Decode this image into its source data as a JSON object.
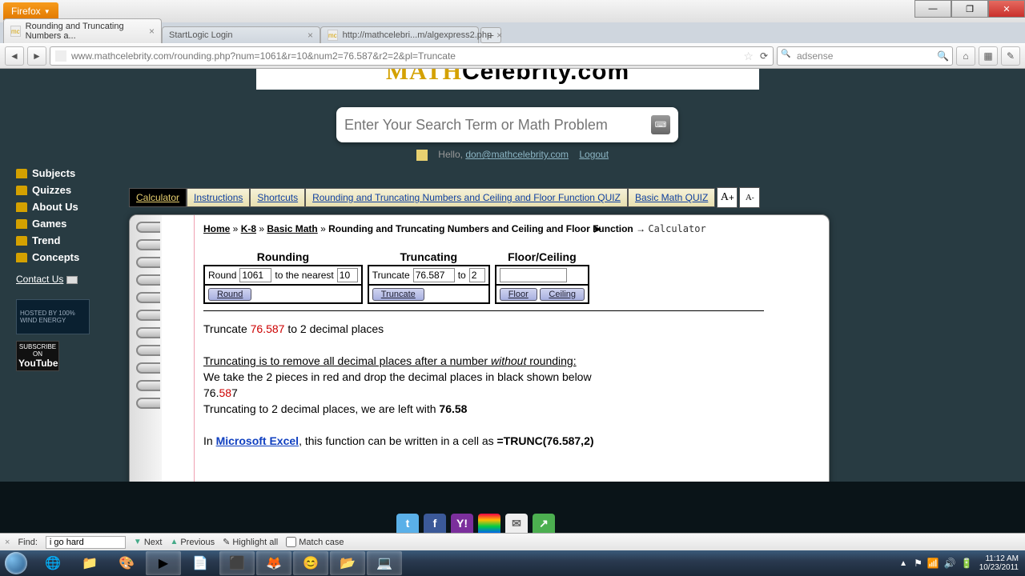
{
  "browser": {
    "menu_label": "Firefox",
    "tabs": [
      {
        "title": "Rounding and Truncating Numbers a...",
        "active": true
      },
      {
        "title": "StartLogic Login",
        "active": false
      },
      {
        "title": "http://mathcelebri...m/algexpress2.php",
        "active": false
      }
    ],
    "url": "www.mathcelebrity.com/rounding.php?num=1061&r=10&num2=76.587&r2=2&pl=Truncate",
    "search_placeholder": "adsense"
  },
  "page": {
    "logo_math": "MATH",
    "logo_rest": "Celebrity.com",
    "search_placeholder": "Enter Your Search Term or Math Problem",
    "hello": "Hello,",
    "email": "don@mathcelebrity.com",
    "logout": "Logout",
    "sidebar": [
      "Subjects",
      "Quizzes",
      "About Us",
      "Games",
      "Trend",
      "Concepts"
    ],
    "contact": "Contact Us",
    "wind_badge": "HOSTED BY 100% WIND ENERGY",
    "yt_sub": "SUBSCRIBE ON",
    "yt": "YouTube",
    "qtabs": [
      "Calculator",
      "Instructions",
      "Shortcuts",
      "Rounding and Truncating Numbers and Ceiling and Floor Function QUIZ",
      "Basic Math QUIZ"
    ],
    "font_big": "A ̂",
    "font_small": "A ˇ",
    "crumb": {
      "home": "Home",
      "k8": "K-8",
      "basic": "Basic Math",
      "topic": "Rounding and Truncating Numbers and Ceiling and Floor Function",
      "arrow": "→",
      "cur": "Calculator"
    },
    "headers": {
      "round": "Rounding",
      "trunc": "Truncating",
      "fc": "Floor/Ceiling"
    },
    "round": {
      "lbl": "Round",
      "val": "1061",
      "mid": "to the nearest",
      "to": "10",
      "btn": "Round"
    },
    "trunc": {
      "lbl": "Truncate",
      "val": "76.587",
      "mid": "to",
      "to": "2",
      "btn": "Truncate"
    },
    "fc": {
      "val": "",
      "floor": "Floor",
      "ceil": "Ceiling"
    },
    "explain": {
      "l1a": "Truncate ",
      "l1b": "76.587",
      "l1c": " to 2 decimal places",
      "l2a": "Truncating is to remove all decimal places after a number ",
      "l2b": "without",
      "l2c": " rounding:",
      "l3": "We take the 2 pieces in red and drop the decimal places in black shown below",
      "l4a": "76.",
      "l4b": "58",
      "l4c": "7",
      "l5a": "Truncating to 2 decimal places, we are left with ",
      "l5b": "76.58",
      "l6a": "In ",
      "l6b": "Microsoft Excel",
      "l6c": ", this function can be written in a cell as ",
      "l6d": "=TRUNC(76.587,2)"
    }
  },
  "findbar": {
    "label": "Find:",
    "value": "i go hard",
    "next": "Next",
    "prev": "Previous",
    "hl": "Highlight all",
    "mc": "Match case"
  },
  "tray": {
    "time": "11:12 AM",
    "date": "10/23/2011"
  }
}
